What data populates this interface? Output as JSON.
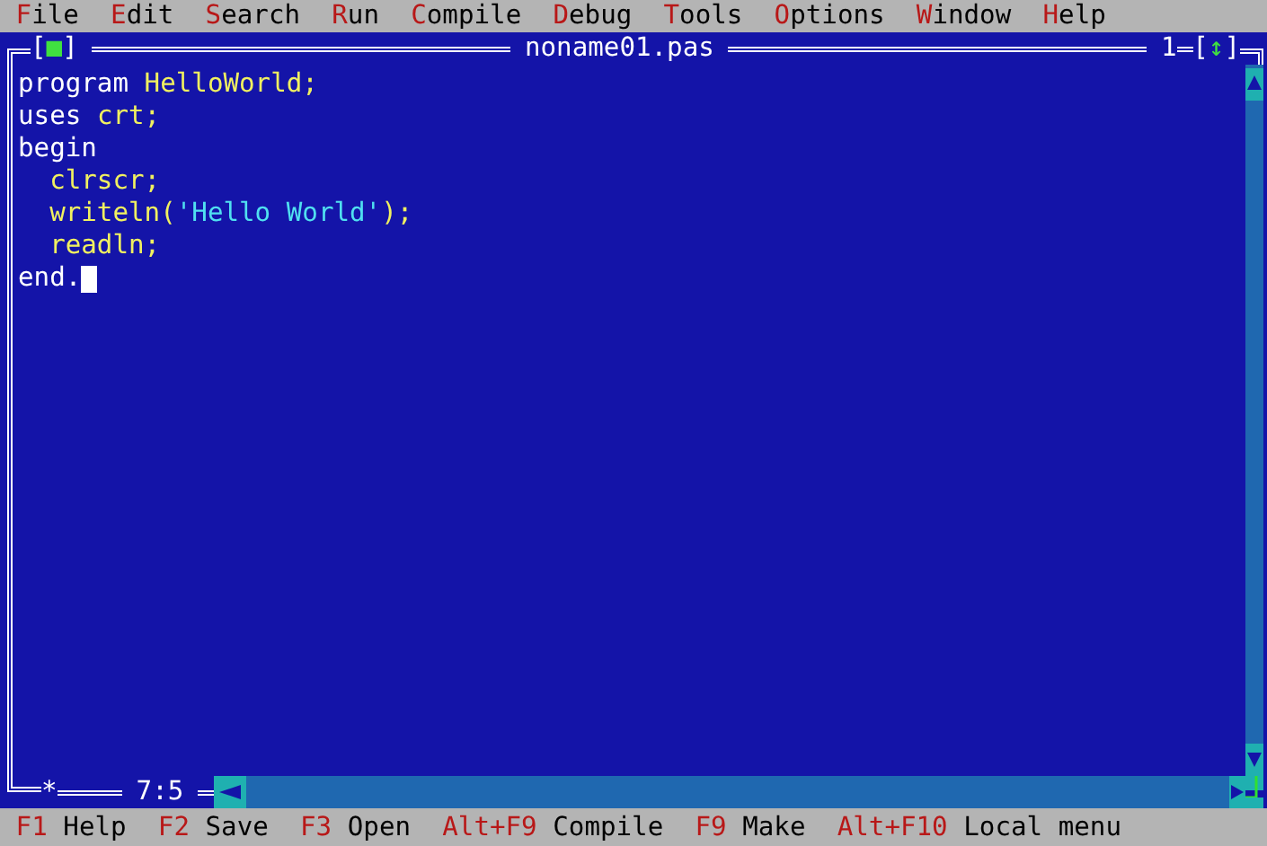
{
  "menu": [
    {
      "label": "File"
    },
    {
      "label": "Edit"
    },
    {
      "label": "Search"
    },
    {
      "label": "Run"
    },
    {
      "label": "Compile"
    },
    {
      "label": "Debug"
    },
    {
      "label": "Tools"
    },
    {
      "label": "Options"
    },
    {
      "label": "Window"
    },
    {
      "label": "Help"
    }
  ],
  "window": {
    "title": "noname01.pas",
    "number": "1",
    "close_button": {
      "open": "[",
      "glyph": "■",
      "close": "]"
    },
    "zoom_button": {
      "open": "[",
      "glyph": "↕",
      "close": "]"
    },
    "modified": "*",
    "position": "7:5"
  },
  "code": [
    {
      "cursor": false,
      "tokens": [
        {
          "kind": "keyword",
          "text": "program"
        },
        {
          "kind": "ident",
          "text": " HelloWorld;"
        }
      ]
    },
    {
      "cursor": false,
      "tokens": [
        {
          "kind": "keyword",
          "text": "uses"
        },
        {
          "kind": "ident",
          "text": " crt;"
        }
      ]
    },
    {
      "cursor": false,
      "tokens": [
        {
          "kind": "keyword",
          "text": "begin"
        }
      ]
    },
    {
      "cursor": false,
      "tokens": [
        {
          "kind": "ident",
          "text": "  clrscr;"
        }
      ]
    },
    {
      "cursor": false,
      "tokens": [
        {
          "kind": "ident",
          "text": "  writeln("
        },
        {
          "kind": "string",
          "text": "'Hello World'"
        },
        {
          "kind": "ident",
          "text": ");"
        }
      ]
    },
    {
      "cursor": false,
      "tokens": [
        {
          "kind": "ident",
          "text": "  readln;"
        }
      ]
    },
    {
      "cursor": true,
      "tokens": [
        {
          "kind": "keyword",
          "text": "end."
        }
      ]
    }
  ],
  "status_bar": [
    {
      "key": "F1",
      "label": "Help"
    },
    {
      "key": "F2",
      "label": "Save"
    },
    {
      "key": "F3",
      "label": "Open"
    },
    {
      "key": "Alt+F9",
      "label": "Compile"
    },
    {
      "key": "F9",
      "label": "Make"
    },
    {
      "key": "Alt+F10",
      "label": "Local menu"
    }
  ]
}
